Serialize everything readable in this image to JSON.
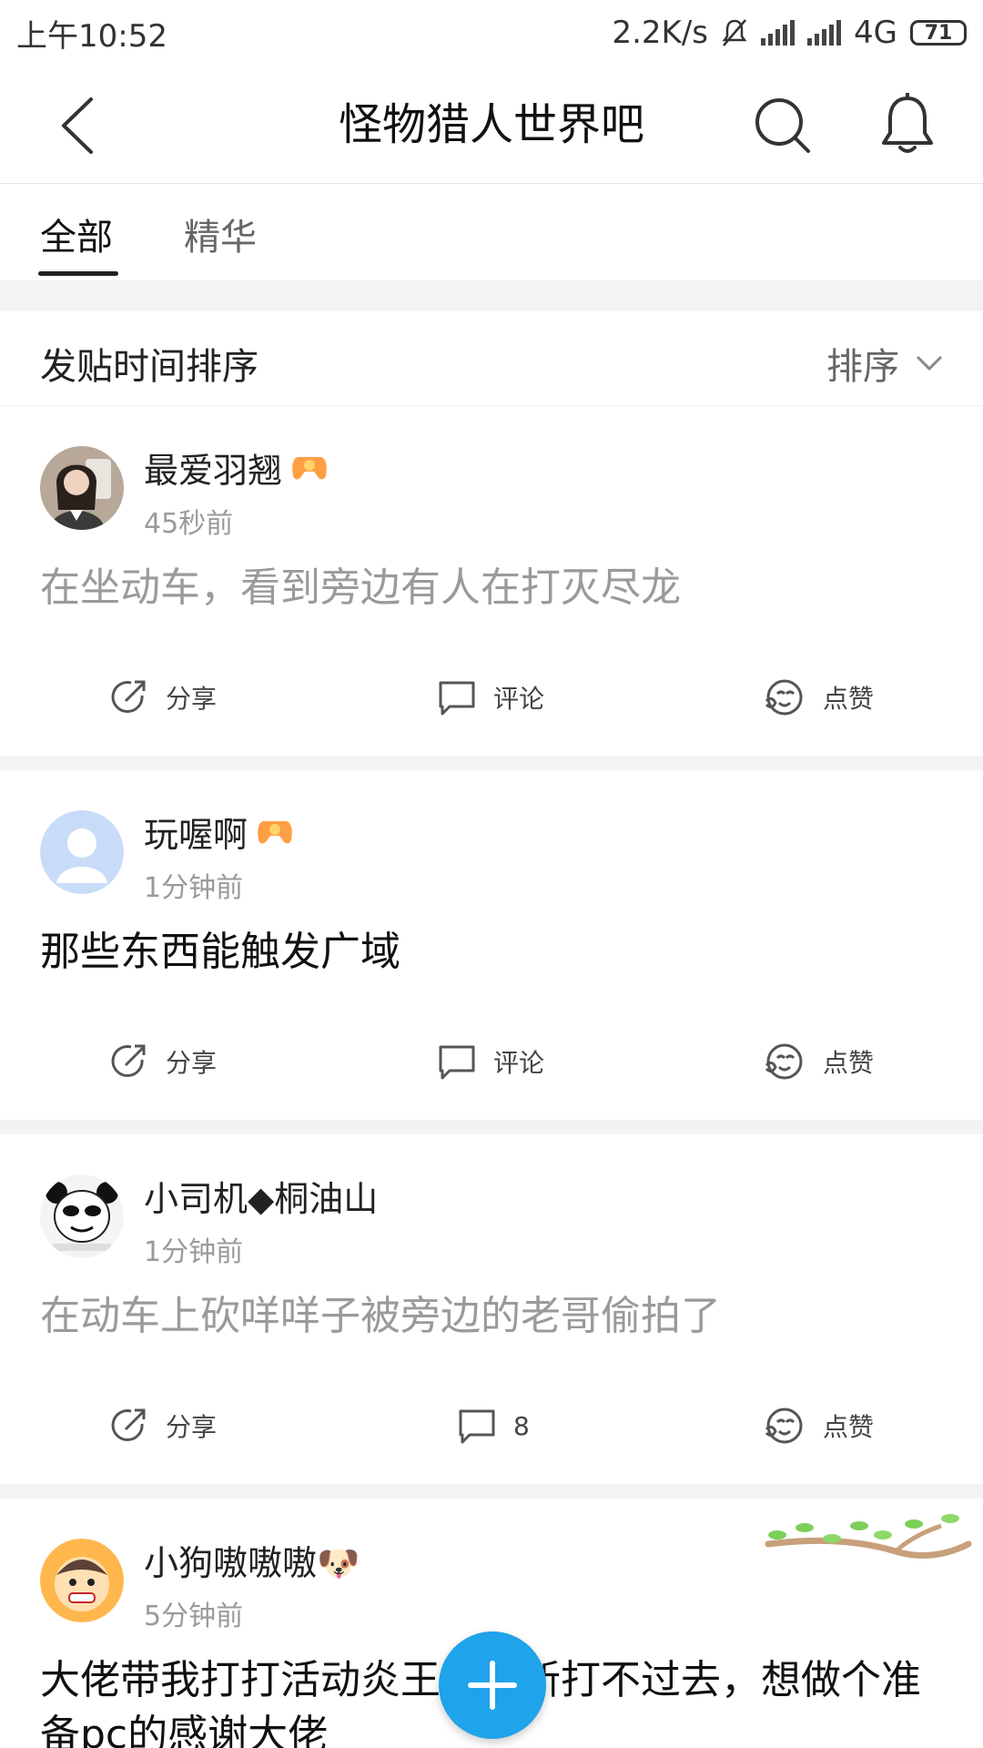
{
  "status": {
    "time": "上午10:52",
    "speed": "2.2K/s",
    "network": "4G",
    "battery": "71"
  },
  "nav": {
    "title": "怪物猎人世界吧"
  },
  "tabs": [
    {
      "label": "全部",
      "active": true
    },
    {
      "label": "精华",
      "active": false
    }
  ],
  "sort": {
    "title": "发贴时间排序",
    "button": "排序"
  },
  "posts": [
    {
      "user": "最爱羽翘",
      "time": "45秒前",
      "content": "在坐动车，看到旁边有人在打灭尽龙",
      "share": "分享",
      "comment": "评论",
      "like": "点赞"
    },
    {
      "user": "玩喔啊",
      "time": "1分钟前",
      "content": "那些东西能触发广域",
      "share": "分享",
      "comment": "评论",
      "like": "点赞"
    },
    {
      "user": "小司机◆桐油山",
      "time": "1分钟前",
      "content": "在动车上砍咩咩子被旁边的老哥偷拍了",
      "share": "分享",
      "comment": "8",
      "like": "点赞"
    },
    {
      "user": "小狗嗷嗷嗷🐶",
      "time": "5分钟前",
      "content": "大佬带我打打活动炎王龙萌新打不过去，想做个准备pc的感谢大佬"
    }
  ],
  "colors": {
    "accent": "#1fa3ea",
    "muted_text": "#9a9a9a"
  }
}
